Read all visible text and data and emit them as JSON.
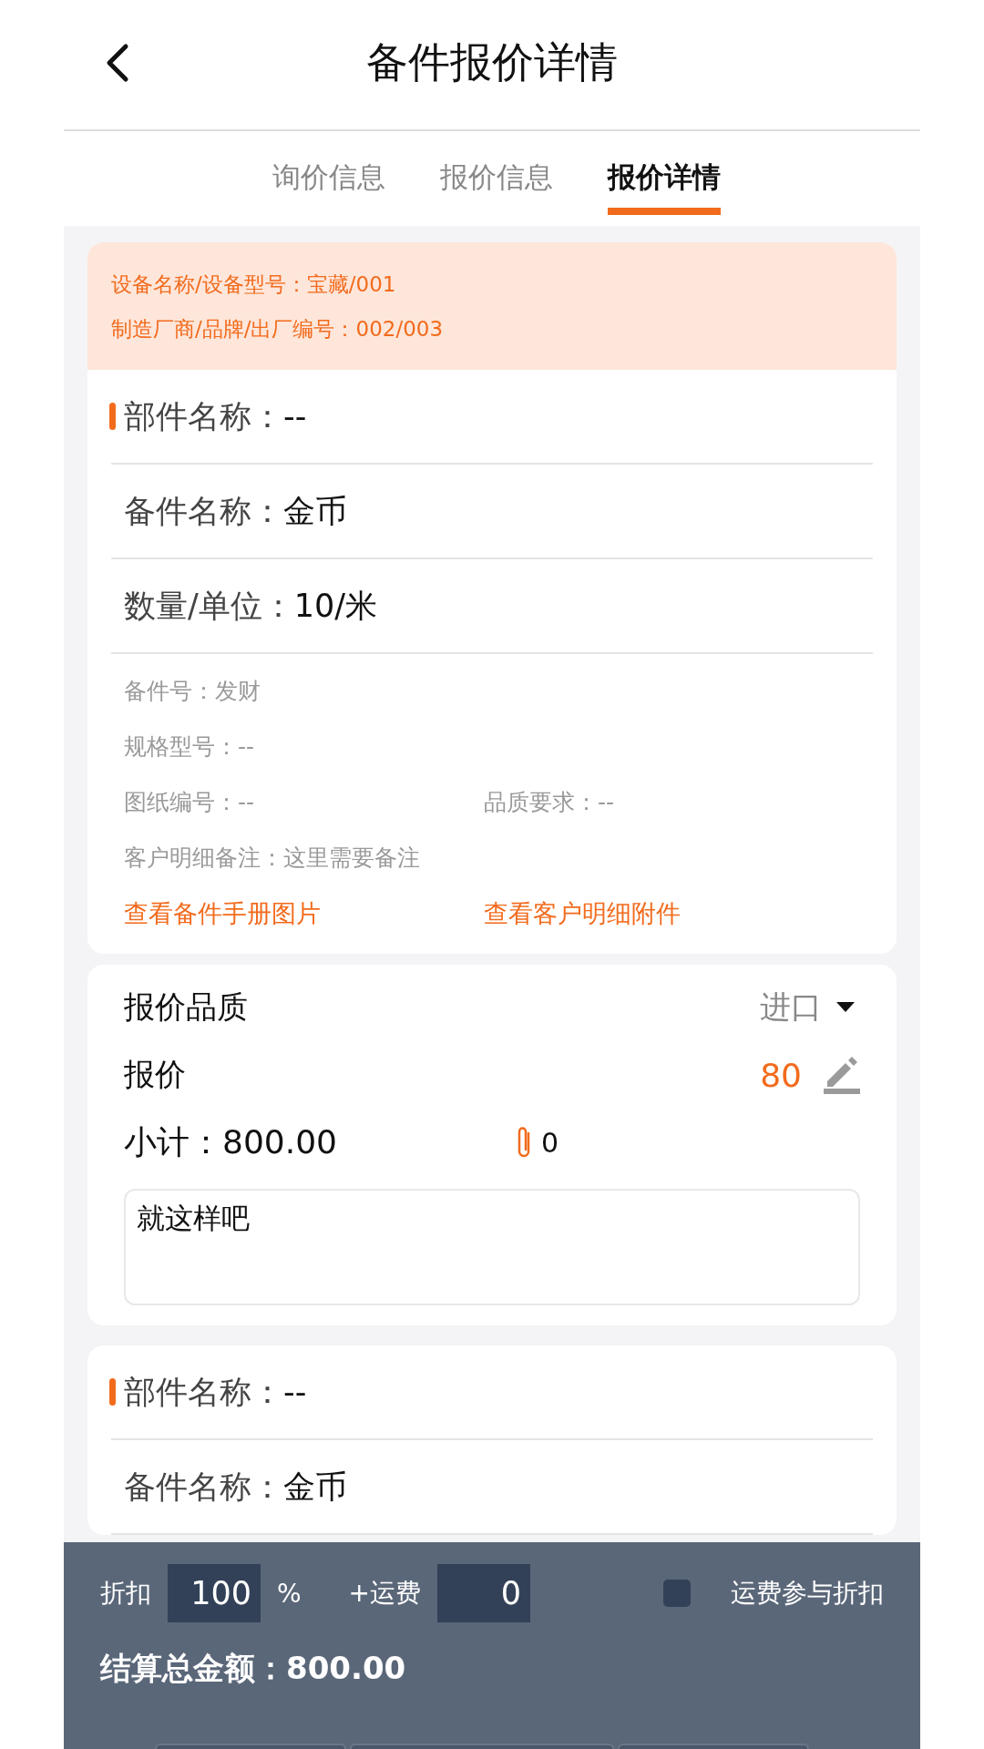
{
  "header": {
    "title": "备件报价详情"
  },
  "tabs": [
    {
      "label": "询价信息",
      "selected": false
    },
    {
      "label": "报价信息",
      "selected": false
    },
    {
      "label": "报价详情",
      "selected": true
    }
  ],
  "device_info": [
    "设备名称/设备型号：宝藏/001",
    "制造厂商/品牌/出厂编号：002/003"
  ],
  "part": {
    "part_name_label": "部件名称：",
    "part_name": "--",
    "spare_name_label": "备件名称：",
    "spare_name": "金币",
    "qty_label": "数量/单位：",
    "qty": "10/米",
    "details": [
      [
        "备件号：发财"
      ],
      [
        "规格型号：--"
      ],
      [
        "图纸编号：--",
        "品质要求：--"
      ],
      [
        "客户明细备注：这里需要备注"
      ]
    ],
    "links": [
      "查看备件手册图片",
      "查看客户明细附件"
    ]
  },
  "quote": {
    "quality_label": "报价品质",
    "quality": "进口",
    "price_label": "报价",
    "price": "80",
    "subtotal": "小计：800.00",
    "attachments": "0",
    "remark": "就这样吧"
  },
  "next_part": {
    "part_name_label": "部件名称：",
    "part_name": "--",
    "spare_name_label": "备件名称：",
    "spare_name": "金币"
  },
  "footer": {
    "discount_label": "折扣",
    "discount": "100",
    "percent": "%",
    "freight_label": "+运费",
    "freight": "0",
    "freight_discount": {
      "label": "运费参与折扣",
      "checked": false
    },
    "total": "结算总金额：800.00"
  }
}
